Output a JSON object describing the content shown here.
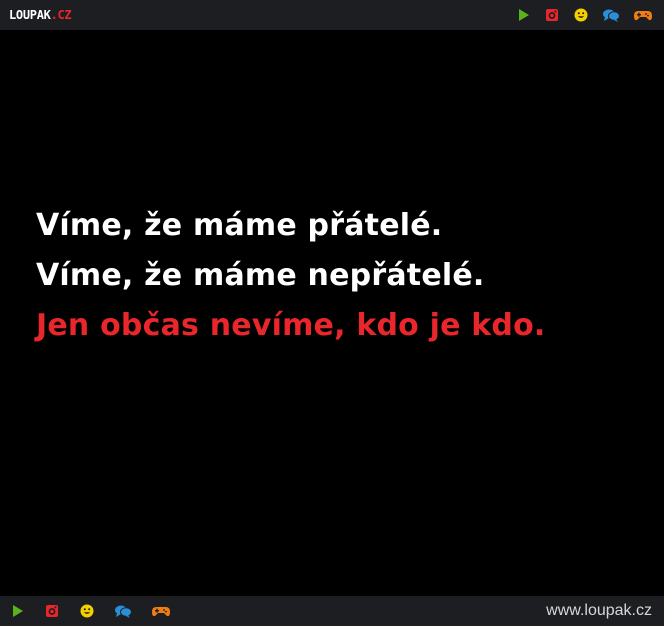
{
  "header": {
    "logo_main": "LOUPAK",
    "logo_suffix": ".CZ",
    "icons": [
      "play-icon",
      "instagram-icon",
      "smiley-icon",
      "chat-icon",
      "gamepad-icon"
    ]
  },
  "content": {
    "line1": "Víme, že máme přátelé.",
    "line2": "Víme, že máme nepřátelé.",
    "line3": "Jen občas nevíme, kdo je kdo."
  },
  "footer": {
    "site_url": "www.loupak.cz",
    "icons": [
      "play-icon",
      "instagram-icon",
      "smiley-icon",
      "chat-icon",
      "gamepad-icon"
    ]
  },
  "colors": {
    "background": "#000000",
    "bar": "#1c1e21",
    "text_primary": "#ffffff",
    "text_accent": "#e8262b",
    "play": "#5bb31c",
    "instagram": "#e8262b",
    "smiley": "#f5d000",
    "chat": "#2a8fd8",
    "gamepad": "#f07d14"
  }
}
